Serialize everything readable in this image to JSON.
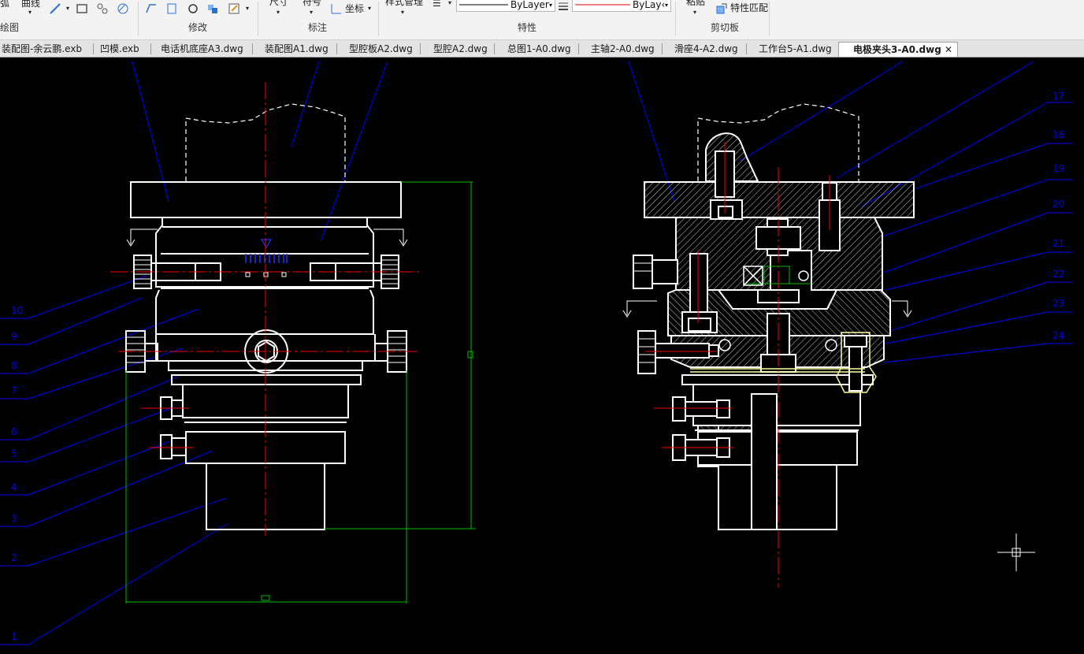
{
  "ribbon": {
    "draw_label_partial": "弧",
    "curve_label": "曲线",
    "dimension_label": "尺寸",
    "symbol_label": "符号",
    "coordinate_label": "坐标",
    "style_manager_label": "样式管理",
    "paste_label": "粘贴",
    "match_properties_label": "特性匹配",
    "linetype_value": "ByLayer",
    "linecolor_value": "ByLay‹",
    "groups": {
      "draw": "绘图",
      "modify": "修改",
      "annotate": "标注",
      "properties": "特性",
      "clipboard": "剪切板"
    }
  },
  "tabs": [
    {
      "label": "装配图-余云鹏.exb"
    },
    {
      "label": "凹模.exb"
    },
    {
      "label": "电话机底座A3.dwg"
    },
    {
      "label": "装配图A1.dwg"
    },
    {
      "label": "型腔板A2.dwg"
    },
    {
      "label": "型腔A2.dwg"
    },
    {
      "label": "总图1-A0.dwg"
    },
    {
      "label": "主轴2-A0.dwg"
    },
    {
      "label": "滑座4-A2.dwg"
    },
    {
      "label": "工作台5-A1.dwg"
    },
    {
      "label": "电极夹头3-A0.dwg",
      "active": true
    }
  ],
  "tab_close_glyph": "✕",
  "balloons_left": [
    "10",
    "9",
    "8",
    "7",
    "6",
    "5",
    "4",
    "3",
    "2",
    "1"
  ],
  "balloons_right": [
    "17",
    "18",
    "19",
    "20",
    "21",
    "22",
    "23",
    "24"
  ],
  "colors": {
    "canvas": "#000000",
    "geometry": "#ffffff",
    "centerline": "#ff0000",
    "leader": "#0000ff",
    "dimension": "#00c000",
    "hatch": "#ffffff",
    "highlight": "#ffff99"
  }
}
